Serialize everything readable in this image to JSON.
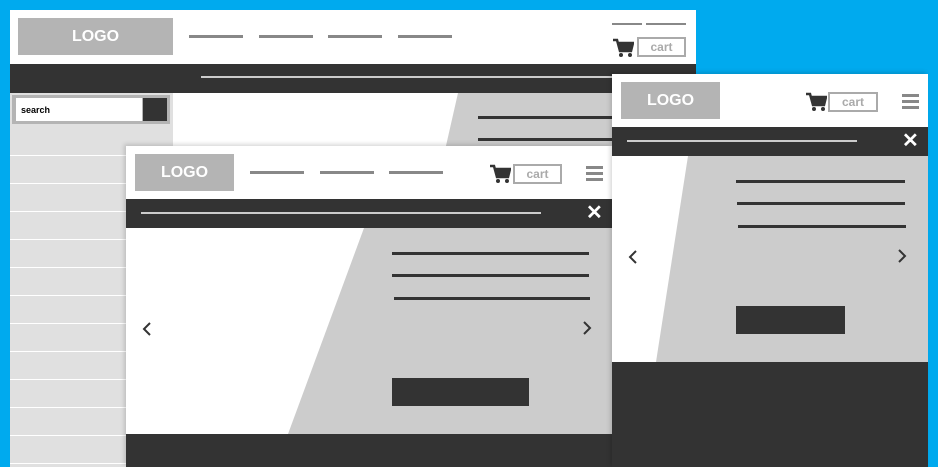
{
  "colors": {
    "background": "#00aaee",
    "dark": "#333333",
    "mid_gray": "#b4b4b4",
    "light_gray": "#cccccc"
  },
  "desktop": {
    "logo": "LOGO",
    "cart_label": "cart",
    "search_placeholder": "search",
    "icons": [
      "cart-icon",
      "search-button"
    ]
  },
  "tablet": {
    "logo": "LOGO",
    "cart_label": "cart",
    "icons": [
      "cart-icon",
      "menu-icon",
      "close-icon",
      "chevron-left-icon",
      "chevron-right-icon"
    ],
    "close_glyph": "✕"
  },
  "mobile": {
    "logo": "LOGO",
    "cart_label": "cart",
    "icons": [
      "cart-icon",
      "menu-icon",
      "close-icon",
      "chevron-left-icon",
      "chevron-right-icon"
    ],
    "close_glyph": "✕"
  }
}
